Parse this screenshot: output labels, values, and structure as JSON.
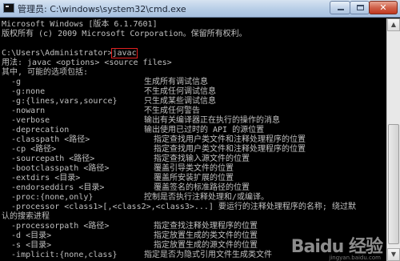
{
  "window": {
    "title": "管理员: C:\\windows\\system32\\cmd.exe",
    "minimize_label": "",
    "maximize_label": "",
    "close_label": "✕"
  },
  "console": {
    "header_line1": "Microsoft Windows [版本 6.1.7601]",
    "header_line2": "版权所有 (c) 2009 Microsoft Corporation。保留所有权利。",
    "prompt": "C:\\Users\\Administrator>",
    "command": "javac",
    "usage": "用法: javac <options> <source files>",
    "options_intro": "其中, 可能的选项包括:",
    "options": [
      {
        "opt": "  -g",
        "desc": "生成所有调试信息"
      },
      {
        "opt": "  -g:none",
        "desc": "不生成任何调试信息"
      },
      {
        "opt": "  -g:{lines,vars,source}",
        "desc": "只生成某些调试信息"
      },
      {
        "opt": "  -nowarn",
        "desc": "不生成任何警告"
      },
      {
        "opt": "  -verbose",
        "desc": "输出有关编译器正在执行的操作的消息"
      },
      {
        "opt": "  -deprecation",
        "desc": "输出使用已过时的 API 的源位置"
      },
      {
        "opt": "  -classpath <路径>",
        "desc": "  指定查找用户类文件和注释处理程序的位置"
      },
      {
        "opt": "  -cp <路径>",
        "desc": "  指定查找用户类文件和注释处理程序的位置"
      },
      {
        "opt": "  -sourcepath <路径>",
        "desc": "  指定查找输入源文件的位置"
      },
      {
        "opt": "  -bootclasspath <路径>",
        "desc": "  覆盖引导类文件的位置"
      },
      {
        "opt": "  -extdirs <目录>",
        "desc": "  覆盖所安装扩展的位置"
      },
      {
        "opt": "  -endorseddirs <目录>",
        "desc": "  覆盖签名的标准路径的位置"
      },
      {
        "opt": "  -proc:{none,only}",
        "desc": "控制是否执行注释处理和/或编译。"
      }
    ],
    "processor_line": "  -processor <class1>[,<class2>,<class3>...] 要运行的注释处理程序的名称; 绕过默",
    "processor_cont": "认的搜索进程",
    "options2": [
      {
        "opt": "  -processorpath <路径>",
        "desc": "  指定查找注释处理程序的位置"
      },
      {
        "opt": "  -d <目录>",
        "desc": "  指定放置生成的类文件的位置"
      },
      {
        "opt": "  -s <目录>",
        "desc": "  指定放置生成的源文件的位置"
      },
      {
        "opt": "  -implicit:{none,class}",
        "desc": "指定是否为隐式引用文件生成类文件"
      }
    ]
  },
  "watermark": {
    "main": "Baidu 经验",
    "sub": "jingyan.baidu.com"
  },
  "colors": {
    "console_bg": "#000000",
    "console_text": "#c0c0c0",
    "highlight_box": "#e02020",
    "titlebar": "#b7cde6"
  }
}
